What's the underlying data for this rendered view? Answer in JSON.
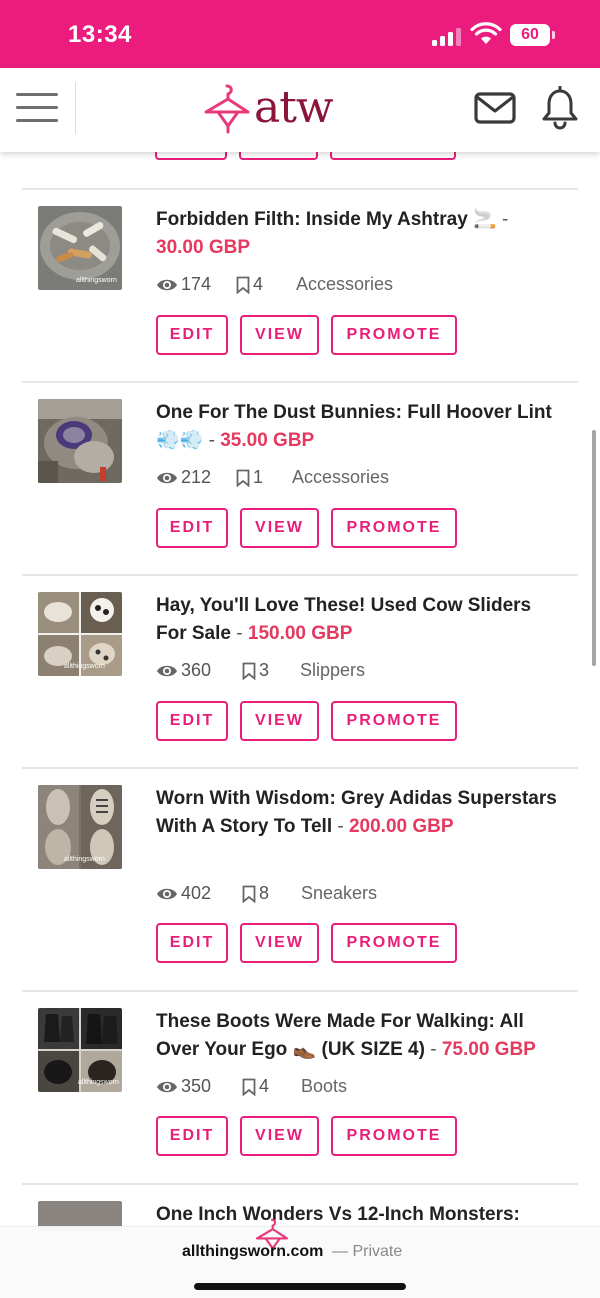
{
  "status_bar": {
    "time": "13:34",
    "battery": "60",
    "icons": [
      "signal-icon",
      "wifi-icon",
      "battery-icon"
    ]
  },
  "header": {
    "logo_text": "atw",
    "icons": [
      "hamburger-menu-icon",
      "hanger-logo-icon",
      "mail-icon",
      "bell-icon"
    ]
  },
  "buttons": {
    "edit": "EDIT",
    "view": "VIEW",
    "promote": "PROMOTE"
  },
  "listings": [
    {
      "title": "Forbidden Filth: Inside My Ashtray 🚬",
      "dash": "-",
      "price": "30.00 GBP",
      "views": "174",
      "saves": "4",
      "category": "Accessories",
      "watermark": "allthingsworn"
    },
    {
      "title": "One For The Dust Bunnies: Full Hoover Lint 💨💨",
      "dash": "-",
      "price": "35.00 GBP",
      "views": "212",
      "saves": "1",
      "category": "Accessories"
    },
    {
      "title": "Hay, You'll Love These! Used Cow Sliders For Sale",
      "dash": "-",
      "price": "150.00 GBP",
      "views": "360",
      "saves": "3",
      "category": "Slippers",
      "watermark": "allthingsworn"
    },
    {
      "title": "Worn With Wisdom: Grey Adidas Superstars With A Story To Tell",
      "dash": "-",
      "price": "200.00 GBP",
      "views": "402",
      "saves": "8",
      "category": "Sneakers",
      "watermark": "allthingsworn"
    },
    {
      "title": "These Boots Were Made For Walking: All Over Your Ego 👞 (UK SIZE 4)",
      "dash": "-",
      "price": "75.00 GBP",
      "views": "350",
      "saves": "4",
      "category": "Boots",
      "watermark": "allthingsworn"
    },
    {
      "title": "One Inch Wonders Vs 12-Inch Monsters:"
    }
  ],
  "browser": {
    "url": "allthingsworn.com",
    "suffix": "— Private"
  },
  "colors": {
    "brand_pink": "#ec1c7f",
    "button_pink": "#e91e7a",
    "price_red": "#e5395f",
    "logo_maroon": "#8a1538"
  }
}
